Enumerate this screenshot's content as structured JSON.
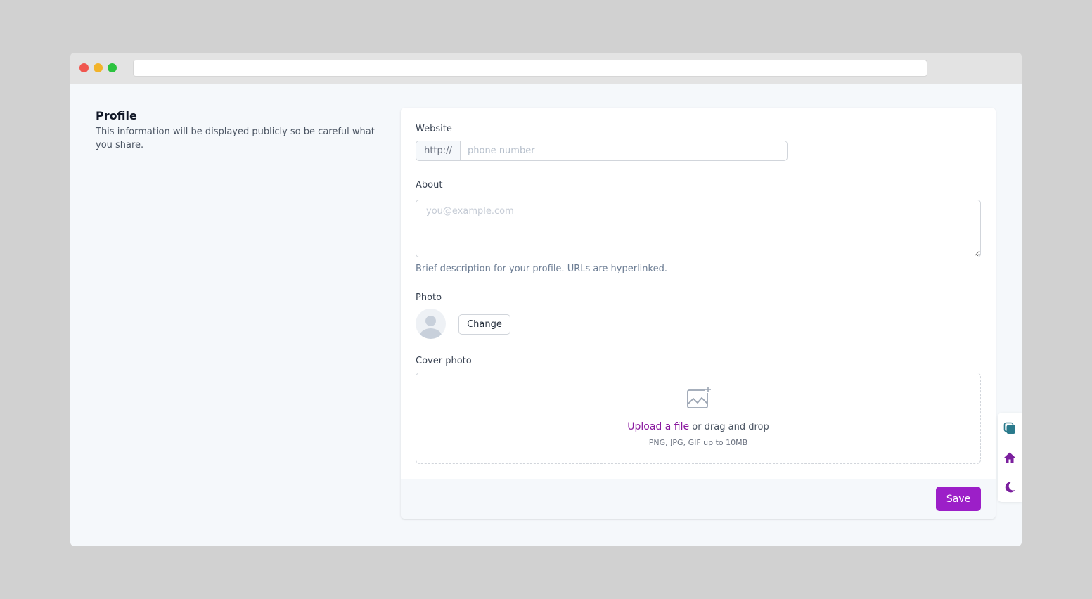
{
  "profile": {
    "heading": "Profile",
    "description": "This information will be displayed publicly so be careful what you share."
  },
  "form": {
    "website": {
      "label": "Website",
      "prefix": "http://",
      "placeholder": "phone number"
    },
    "about": {
      "label": "About",
      "placeholder": "you@example.com",
      "helper": "Brief description for your profile. URLs are hyperlinked."
    },
    "photo": {
      "label": "Photo",
      "change_button": "Change"
    },
    "cover_photo": {
      "label": "Cover photo",
      "upload_link": "Upload a file",
      "upload_text": "or drag and drop",
      "hint": "PNG, JPG, GIF up to 10MB"
    },
    "save_button": "Save"
  },
  "floating_toolbar": {
    "icons": [
      "copy-icon",
      "home-icon",
      "moon-icon"
    ]
  },
  "colors": {
    "accent": "#9c1fc8",
    "link": "#8a1a9f",
    "teal_icon": "#2a7a8c"
  }
}
